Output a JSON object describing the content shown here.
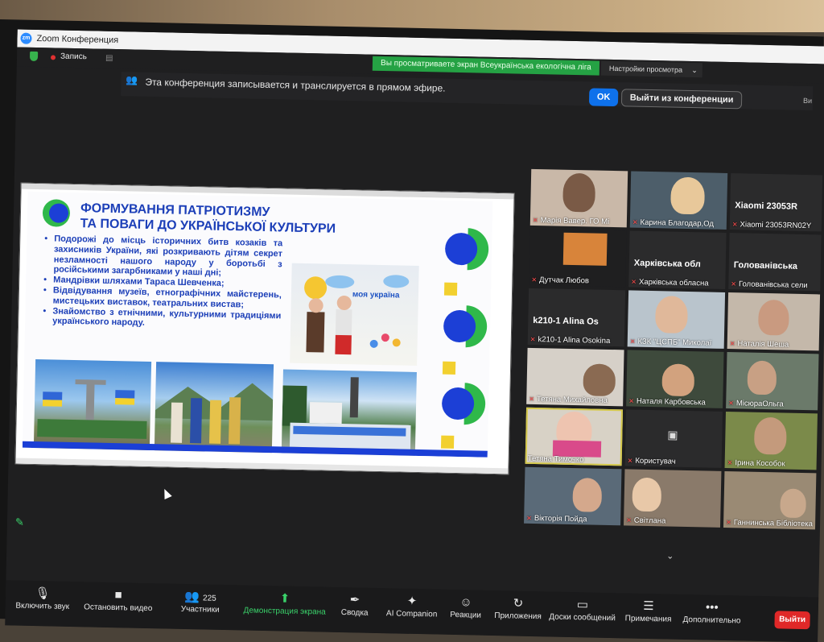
{
  "window": {
    "title": "Zoom Конференция"
  },
  "recording": {
    "label": "Запись"
  },
  "share_banner": {
    "text": "Вы просматриваете экран Всеукраїнська екологічна ліга",
    "view_settings": "Настройки просмотра"
  },
  "notice": {
    "text": "Эта конференция записывается и транслируется в прямом эфире.",
    "ok_label": "OK",
    "leave_label": "Выйти из конференции",
    "view_label": "Ви"
  },
  "slide": {
    "title_line1": "ФОРМУВАННЯ ПАТРІОТИЗМУ",
    "title_line2": "ТА ПОВАГИ ДО УКРАЇНСЬКОЇ КУЛЬТУРИ",
    "bullets": [
      "Подорожі до місць історичних битв козаків та захисників України, які розкривають дітям секрет незламності нашого народу у боротьбі з російськими загарбниками у наші дні;",
      "Мандрівки шляхами Тараса Шевченка;",
      "Відвідування музеїв, етнографічних майстерень, мистецьких виставок, театральних вистав;",
      "Знайомство з етнічними, культурними традиціями українського народу."
    ],
    "photo_caption": "моя україна"
  },
  "participants": [
    {
      "name": "Марія Вавер. ГО Мі",
      "muted": true
    },
    {
      "name": "Карина Благодар,Од",
      "muted": true
    },
    {
      "name": "Xiaomi 23053RN02Y",
      "big": "Xiaomi 23053R",
      "muted": true
    },
    {
      "name": "Дутчак Любов",
      "muted": true
    },
    {
      "name": "Харківська обласна",
      "big": "Харківська обл",
      "muted": true
    },
    {
      "name": "Голованівська сели",
      "big": "Голованівська",
      "muted": true
    },
    {
      "name": "k210-1 Alina Osokina",
      "big": "k210-1 Alina Os",
      "muted": true
    },
    {
      "name": "КЗК \"ЦСПБ\" Миколаї",
      "muted": true
    },
    {
      "name": "Наталія Шеша",
      "muted": true
    },
    {
      "name": "Тетяна Михайловна",
      "muted": true
    },
    {
      "name": "Наталя Карбовська",
      "muted": true
    },
    {
      "name": "МісюраОльга",
      "muted": true
    },
    {
      "name": "Тетяна Тимочко",
      "muted": false
    },
    {
      "name": "Користувач",
      "muted": true
    },
    {
      "name": "Ірина Кособок",
      "muted": true
    },
    {
      "name": "Вікторія Пойда",
      "muted": true
    },
    {
      "name": "Світлана",
      "muted": true
    },
    {
      "name": "Ганнинська Бібліотека",
      "muted": true
    }
  ],
  "toolbar": {
    "unmute": "Включить звук",
    "stop_video": "Остановить видео",
    "participants": "Участники",
    "participants_count": "225",
    "share": "Демонстрация экрана",
    "summary": "Сводка",
    "ai": "AI Companion",
    "reactions": "Реакции",
    "apps": "Приложения",
    "whiteboards": "Доски сообщений",
    "notes": "Примечания",
    "more": "Дополнительно",
    "leave": "Выйти"
  },
  "colors": {
    "accent": "#0e71eb",
    "banner": "#25a244",
    "slide_text": "#1c3fb8",
    "leave": "#e02828"
  }
}
